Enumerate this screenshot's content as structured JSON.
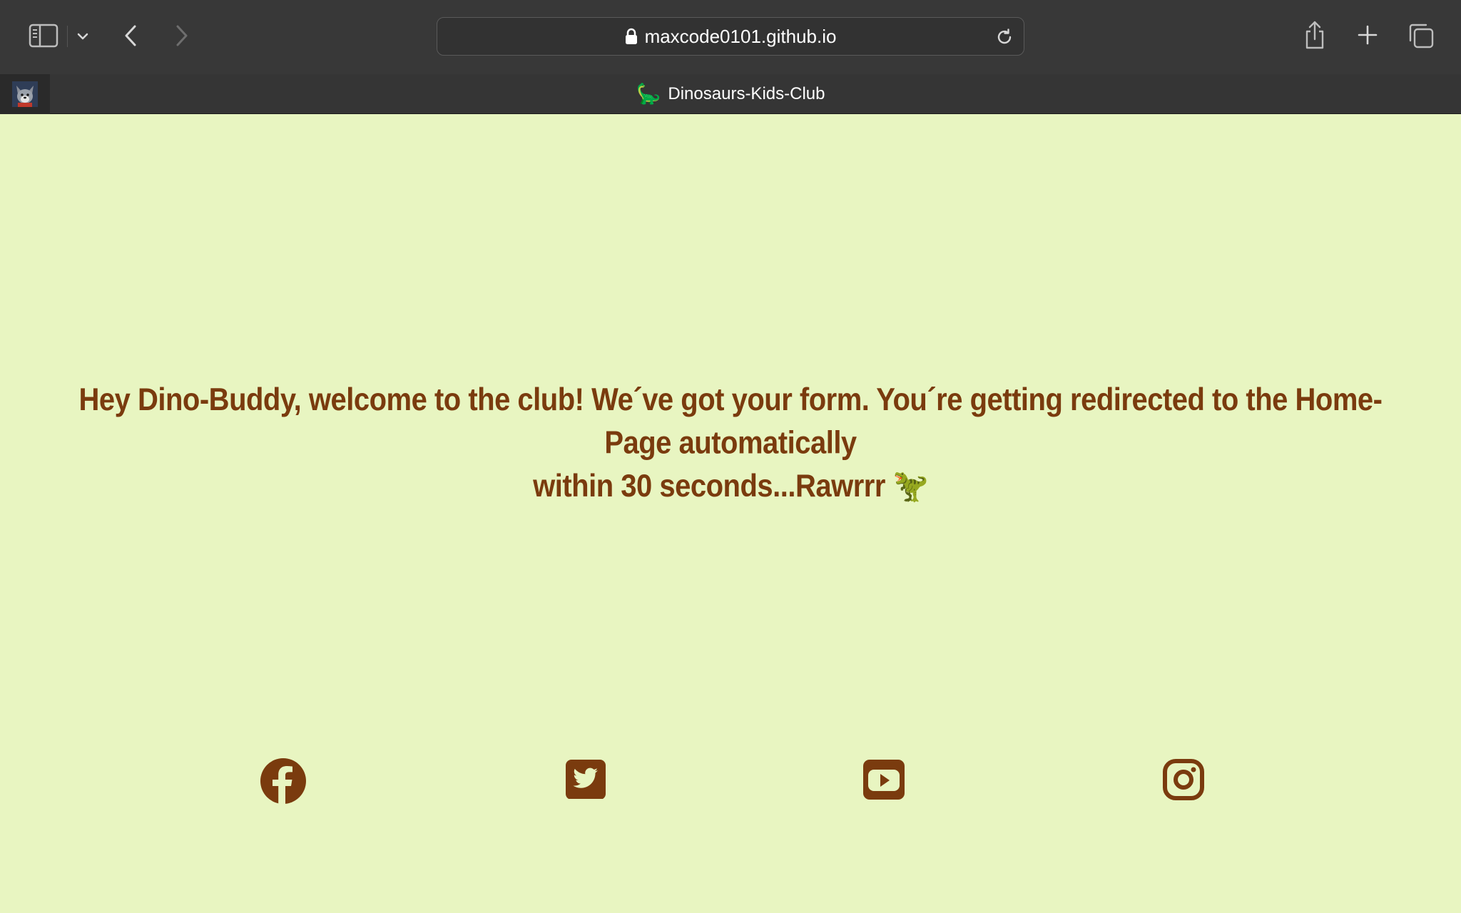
{
  "browser": {
    "url": "maxcode0101.github.io",
    "tab_title": "Dinosaurs-Kids-Club",
    "tab_favicon": "🦕"
  },
  "page": {
    "message_line1": "Hey Dino-Buddy, welcome to the club! We´ve got your form. You´re getting redirected to the Home-Page automatically",
    "message_line2": "within 30 seconds...Rawrrr 🦖"
  },
  "icons": {
    "toolbar": [
      "sidebar-icon",
      "chevron-down-icon",
      "back-icon",
      "forward-icon",
      "lock-icon",
      "reload-icon",
      "share-icon",
      "plus-icon",
      "tabs-icon"
    ],
    "social": [
      "facebook-icon",
      "twitter-icon",
      "youtube-icon",
      "instagram-icon"
    ]
  },
  "colors": {
    "background": "#e8f5c1",
    "text": "#7a3b0e"
  }
}
